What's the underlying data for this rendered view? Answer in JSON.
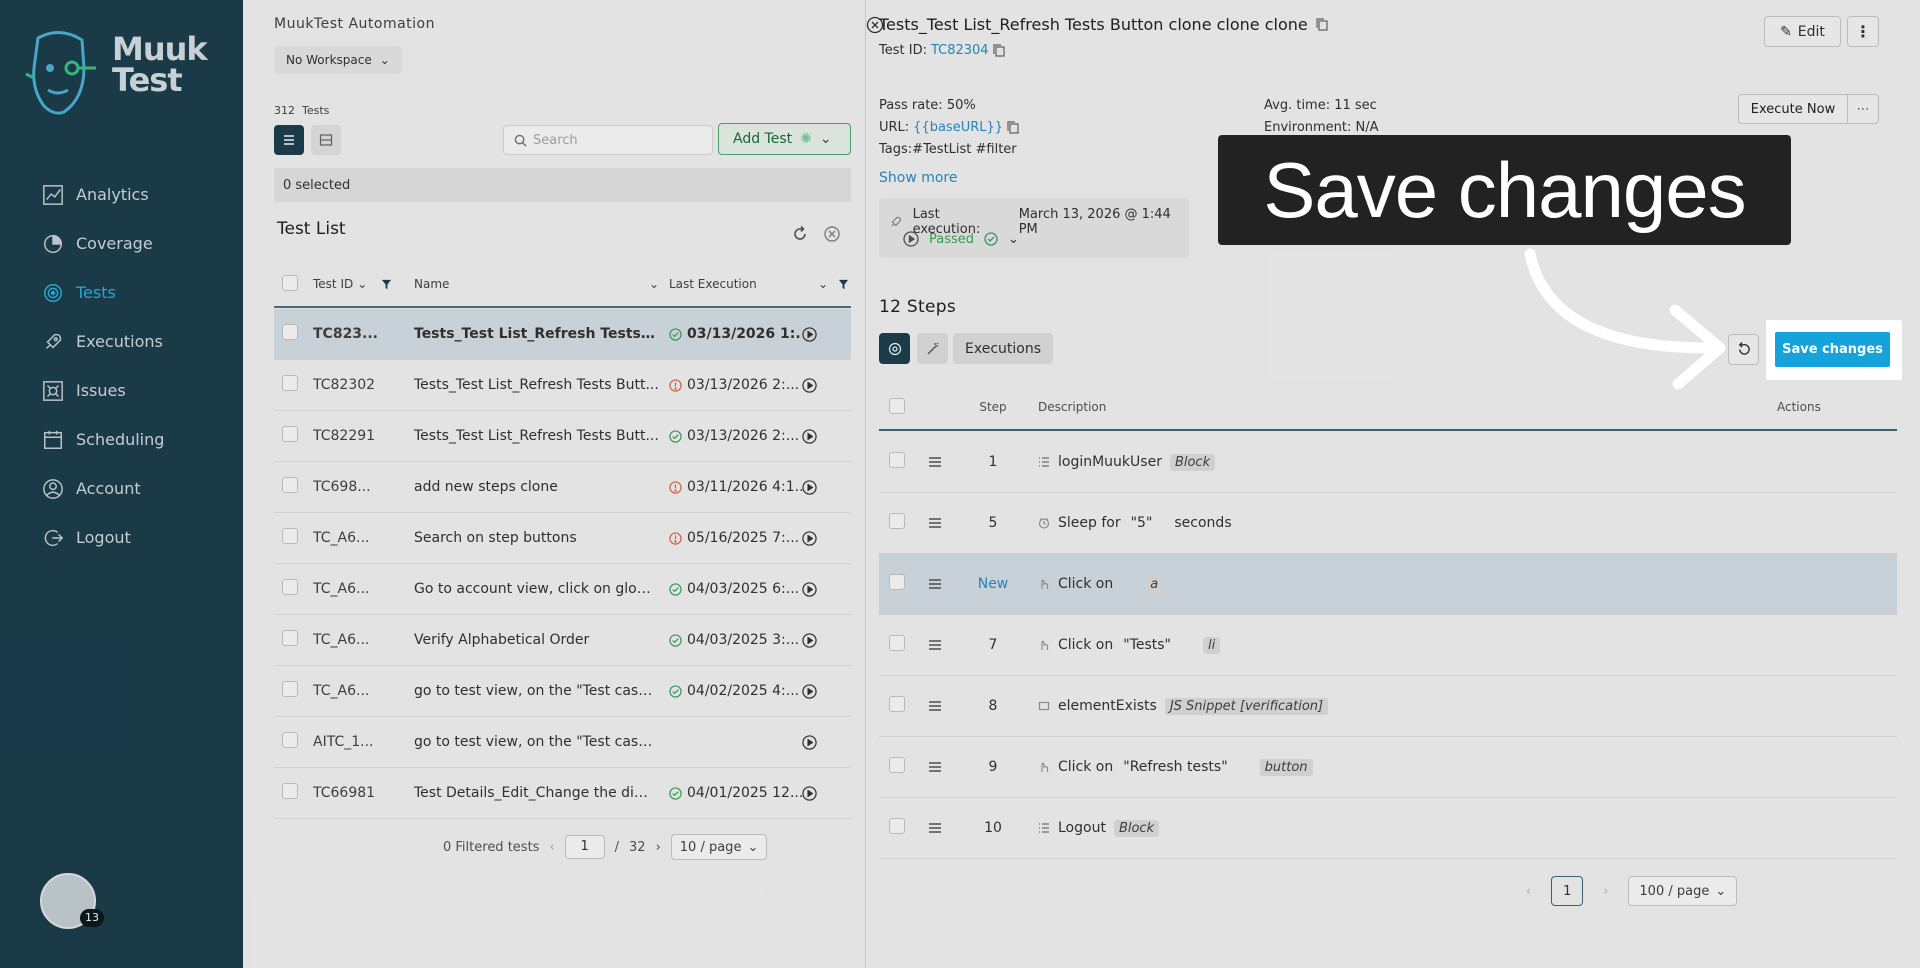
{
  "sidebar": {
    "logo_line1": "Muuk",
    "logo_line2": "Test",
    "items": [
      {
        "label": "Analytics",
        "icon": "chart-icon",
        "active": false
      },
      {
        "label": "Coverage",
        "icon": "pie-icon",
        "active": false
      },
      {
        "label": "Tests",
        "icon": "target-icon",
        "active": true
      },
      {
        "label": "Executions",
        "icon": "rocket-icon",
        "active": false
      },
      {
        "label": "Issues",
        "icon": "bug-icon",
        "active": false
      },
      {
        "label": "Scheduling",
        "icon": "calendar-icon",
        "active": false
      },
      {
        "label": "Account",
        "icon": "user-icon",
        "active": false
      },
      {
        "label": "Logout",
        "icon": "logout-icon",
        "active": false
      }
    ],
    "avatar_badge": "13"
  },
  "left": {
    "app_title": "MuukTest Automation",
    "workspace": "No Workspace",
    "test_count": "312",
    "test_count_label": "Tests",
    "search_placeholder": "Search",
    "add_test": "Add Test",
    "selected": "0 selected",
    "list_title": "Test List",
    "columns": {
      "id": "Test ID",
      "name": "Name",
      "last_exec": "Last Execution"
    },
    "rows": [
      {
        "id": "TC823...",
        "name": "Tests_Test List_Refresh Tests B...",
        "status": "pass",
        "date": "03/13/2026 1:..."
      },
      {
        "id": "TC82302",
        "name": "Tests_Test List_Refresh Tests Butt...",
        "status": "fail",
        "date": "03/13/2026 2:..."
      },
      {
        "id": "TC82291",
        "name": "Tests_Test List_Refresh Tests Butt...",
        "status": "pass",
        "date": "03/13/2026 2:..."
      },
      {
        "id": "TC698...",
        "name": "add new steps clone",
        "status": "fail",
        "date": "03/11/2026 4:1..."
      },
      {
        "id": "TC_A6...",
        "name": "Search on step buttons",
        "status": "fail",
        "date": "05/16/2025 7:..."
      },
      {
        "id": "TC_A6...",
        "name": "Go to account view, click on global v...",
        "status": "pass",
        "date": "04/03/2025 6:..."
      },
      {
        "id": "TC_A6...",
        "name": "Verify Alphabetical Order",
        "status": "pass",
        "date": "04/03/2025 3:..."
      },
      {
        "id": "TC_A6...",
        "name": "go to test view, on the \"Test case to ...",
        "status": "pass",
        "date": "04/02/2025 4:..."
      },
      {
        "id": "AITC_1...",
        "name": "go to test view, on the \"Test case to ...",
        "status": "none",
        "date": ""
      },
      {
        "id": "TC66981",
        "name": "Test Details_Edit_Change the dime...",
        "status": "pass",
        "date": "04/01/2025 12..."
      }
    ],
    "pager": {
      "filtered": "0 Filtered tests",
      "page": "1",
      "sep": "/",
      "total": "32",
      "page_size": "10 / page"
    }
  },
  "detail": {
    "title": "Tests_Test List_Refresh Tests Button clone clone clone",
    "test_id_label": "Test ID:",
    "test_id": "TC82304",
    "edit": "Edit",
    "pass_rate": "Pass rate: 50%",
    "url_label": "URL:",
    "url": "{{baseURL}}",
    "tags_label": "Tags:",
    "tags": "#TestList #filter",
    "avg_time": "Avg. time: 11 sec",
    "environment": "Environment: N/A",
    "execute_now": "Execute Now",
    "show_more": "Show more",
    "last_exec_label": "Last execution:",
    "last_exec_date": "March 13, 2026 @ 1:44 PM",
    "last_exec_status": "Passed",
    "steps_title": "12 Steps",
    "executions_tab": "Executions",
    "save_changes": "Save changes",
    "columns": {
      "step": "Step",
      "description": "Description",
      "actions": "Actions"
    },
    "steps": [
      {
        "num": "1",
        "icon": "list-icon",
        "text": "loginMuukUser",
        "value": "",
        "tag": "Block",
        "new": false
      },
      {
        "num": "5",
        "icon": "clock-icon",
        "text": "Sleep for",
        "value": "\"5\"",
        "extra": "seconds",
        "tag": "",
        "new": false
      },
      {
        "num": "New",
        "icon": "pointer-icon",
        "text": "Click on",
        "value": "",
        "tag": "a",
        "new": true
      },
      {
        "num": "7",
        "icon": "pointer-icon",
        "text": "Click on",
        "value": "\"Tests\"",
        "tag": "li",
        "new": false
      },
      {
        "num": "8",
        "icon": "square-icon",
        "text": "elementExists",
        "value": "",
        "tag": "JS Snippet [verification]",
        "new": false
      },
      {
        "num": "9",
        "icon": "pointer-icon",
        "text": "Click on",
        "value": "\"Refresh tests\"",
        "tag": "button",
        "new": false
      },
      {
        "num": "10",
        "icon": "list-icon",
        "text": "Logout",
        "value": "",
        "tag": "Block",
        "new": false
      }
    ],
    "pager": {
      "page": "1",
      "page_size": "100 / page"
    }
  },
  "callout": {
    "text": "Save changes"
  }
}
